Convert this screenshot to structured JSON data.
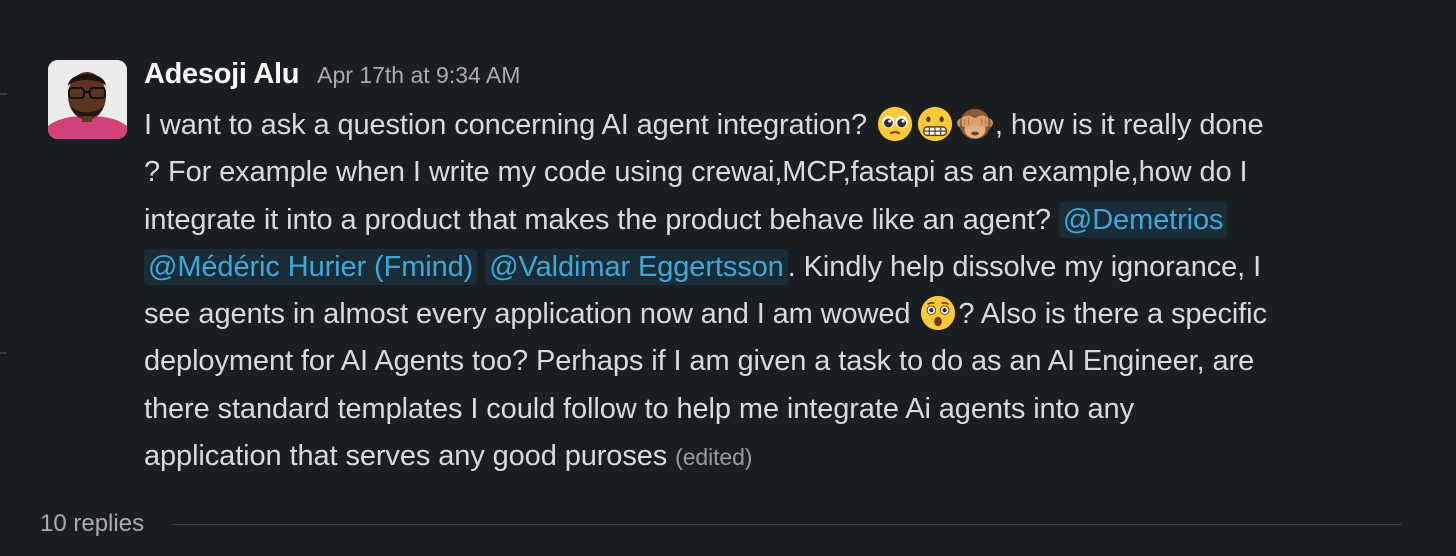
{
  "message": {
    "author": "Adesoji Alu",
    "timestamp": "Apr 17th at 9:34 AM",
    "avatar_icon": "user-avatar-photo",
    "lines": {
      "l1_a": "I want to ask a question concerning AI agent integration? ",
      "l1_b": ", how is it really done",
      "l2": "? For example when I write my code using crewai,MCP,fastapi as an example,how do I",
      "l3": "integrate it into a product that makes the product behave like an agent? ",
      "l4_a": ". Kindly help dissolve my ignorance, I",
      "l5_a": "see agents in almost every application now and I am wowed ",
      "l5_b": "? Also is there a specific",
      "l6": "deployment for AI Agents too? Perhaps if I am given a task to do as an AI Engineer, are",
      "l7": "there standard templates I could follow to help me integrate Ai agents into any",
      "l8": "application that serves any good puroses "
    },
    "mentions": {
      "m1": "@Demetrios",
      "m2": "@Médéric Hurier (Fmind)",
      "m3": "@Valdimar Eggertsson"
    },
    "emojis": [
      "pleading-face-emoji",
      "grimacing-face-emoji",
      "see-no-evil-monkey-emoji",
      "astonished-face-emoji"
    ],
    "edited_label": "(edited)"
  },
  "thread": {
    "replies_label": "10 replies"
  },
  "colors": {
    "background": "#1a1d21",
    "text": "#d9dadb",
    "mention": "#3ea8db",
    "meta": "#ababad"
  }
}
